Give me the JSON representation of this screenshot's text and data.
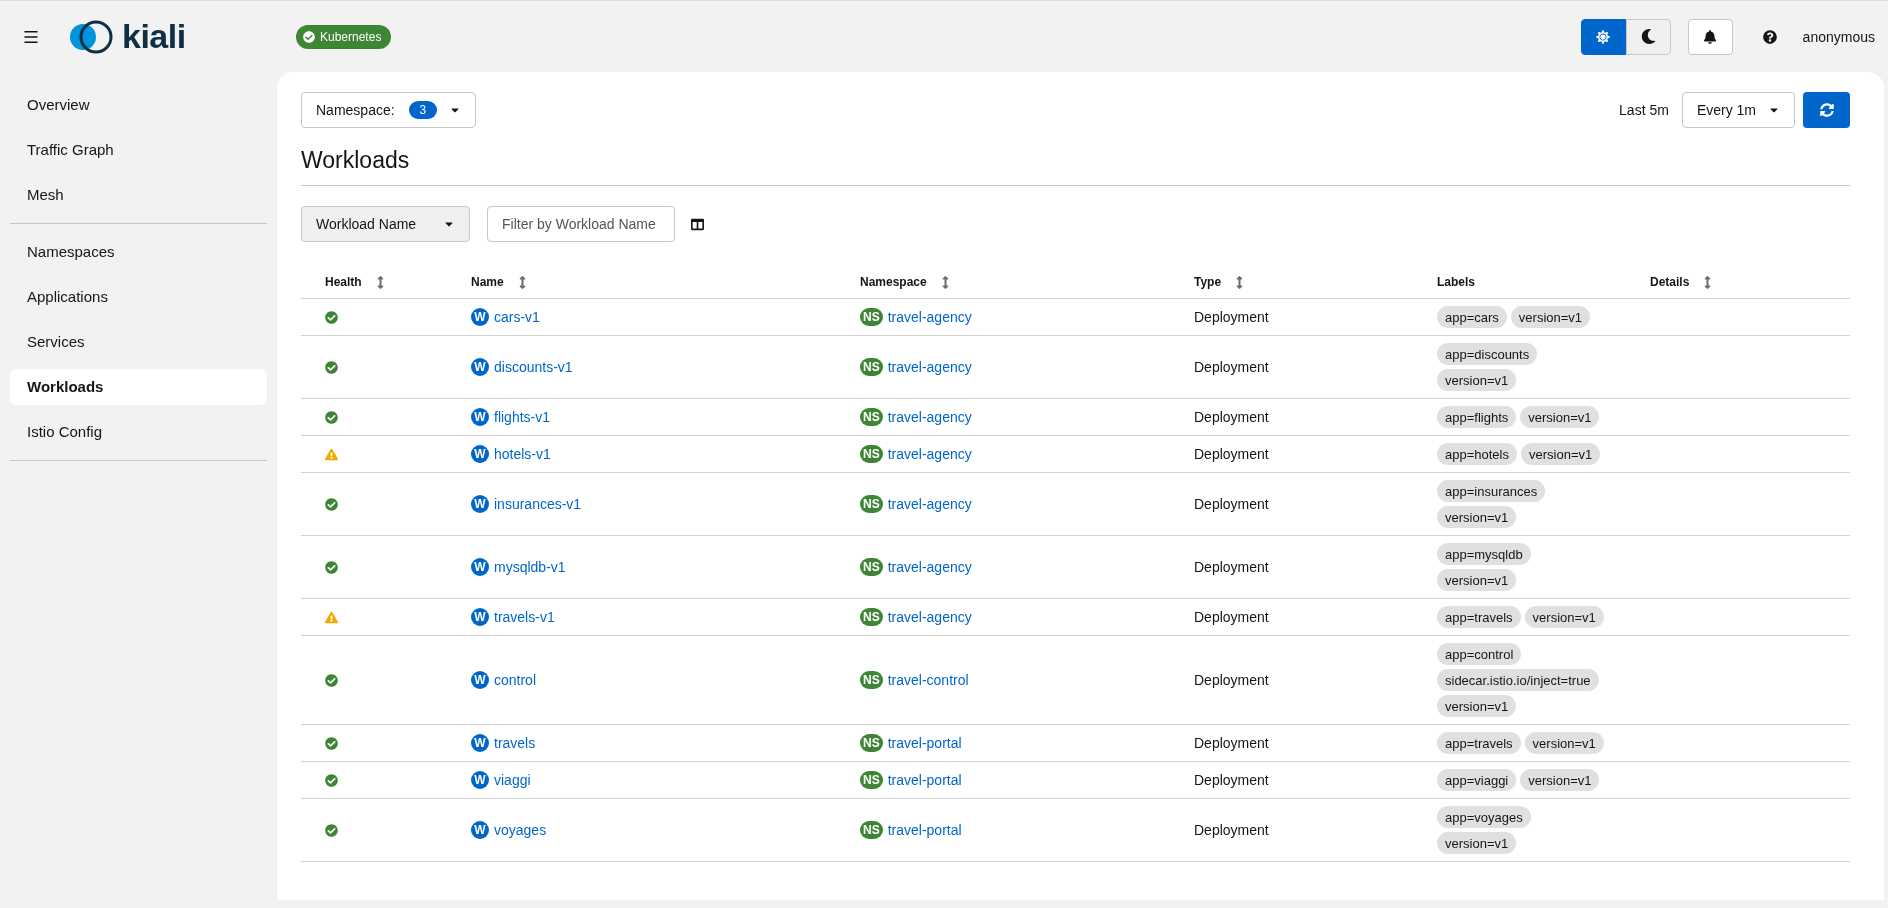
{
  "masthead": {
    "brand": "kiali",
    "cluster_badge": "Kubernetes",
    "theme_toggle": [
      {
        "kind": "light",
        "selected": true
      },
      {
        "kind": "dark",
        "selected": false
      }
    ],
    "user": "anonymous"
  },
  "sidebar": {
    "groups": [
      [
        {
          "label": "Overview",
          "selected": false
        },
        {
          "label": "Traffic Graph",
          "selected": false
        },
        {
          "label": "Mesh",
          "selected": false
        }
      ],
      [
        {
          "label": "Namespaces",
          "selected": false
        },
        {
          "label": "Applications",
          "selected": false
        },
        {
          "label": "Services",
          "selected": false
        },
        {
          "label": "Workloads",
          "selected": true
        },
        {
          "label": "Istio Config",
          "selected": false
        }
      ]
    ]
  },
  "toolbar": {
    "namespace_label": "Namespace:",
    "namespace_count": "3",
    "time_range": "Last 5m",
    "refresh_interval": "Every 1m"
  },
  "title": "Workloads",
  "filter": {
    "attribute": "Workload Name",
    "placeholder": "Filter by Workload Name"
  },
  "table": {
    "columns": [
      {
        "label": "Health",
        "sortable": true
      },
      {
        "label": "Name",
        "sortable": true
      },
      {
        "label": "Namespace",
        "sortable": true
      },
      {
        "label": "Type",
        "sortable": true
      },
      {
        "label": "Labels",
        "sortable": false
      },
      {
        "label": "Details",
        "sortable": true
      }
    ],
    "rows": [
      {
        "kind": "ok",
        "name_badge": "W",
        "name": "cars-v1",
        "namespace_badge": "NS",
        "namespace": "travel-agency",
        "type": "Deployment",
        "label_lines": [
          [
            "app=cars",
            "version=v1"
          ]
        ]
      },
      {
        "kind": "ok",
        "name_badge": "W",
        "name": "discounts-v1",
        "namespace_badge": "NS",
        "namespace": "travel-agency",
        "type": "Deployment",
        "label_lines": [
          [
            "app=discounts"
          ],
          [
            "version=v1"
          ]
        ]
      },
      {
        "kind": "ok",
        "name_badge": "W",
        "name": "flights-v1",
        "namespace_badge": "NS",
        "namespace": "travel-agency",
        "type": "Deployment",
        "label_lines": [
          [
            "app=flights",
            "version=v1"
          ]
        ]
      },
      {
        "kind": "warning",
        "name_badge": "W",
        "name": "hotels-v1",
        "namespace_badge": "NS",
        "namespace": "travel-agency",
        "type": "Deployment",
        "label_lines": [
          [
            "app=hotels",
            "version=v1"
          ]
        ]
      },
      {
        "kind": "ok",
        "name_badge": "W",
        "name": "insurances-v1",
        "namespace_badge": "NS",
        "namespace": "travel-agency",
        "type": "Deployment",
        "label_lines": [
          [
            "app=insurances"
          ],
          [
            "version=v1"
          ]
        ]
      },
      {
        "kind": "ok",
        "name_badge": "W",
        "name": "mysqldb-v1",
        "namespace_badge": "NS",
        "namespace": "travel-agency",
        "type": "Deployment",
        "label_lines": [
          [
            "app=mysqldb"
          ],
          [
            "version=v1"
          ]
        ]
      },
      {
        "kind": "warning",
        "name_badge": "W",
        "name": "travels-v1",
        "namespace_badge": "NS",
        "namespace": "travel-agency",
        "type": "Deployment",
        "label_lines": [
          [
            "app=travels",
            "version=v1"
          ]
        ]
      },
      {
        "kind": "ok",
        "name_badge": "W",
        "name": "control",
        "namespace_badge": "NS",
        "namespace": "travel-control",
        "type": "Deployment",
        "label_lines": [
          [
            "app=control"
          ],
          [
            "sidecar.istio.io/inject=true"
          ],
          [
            "version=v1"
          ]
        ]
      },
      {
        "kind": "ok",
        "name_badge": "W",
        "name": "travels",
        "namespace_badge": "NS",
        "namespace": "travel-portal",
        "type": "Deployment",
        "label_lines": [
          [
            "app=travels",
            "version=v1"
          ]
        ]
      },
      {
        "kind": "ok",
        "name_badge": "W",
        "name": "viaggi",
        "namespace_badge": "NS",
        "namespace": "travel-portal",
        "type": "Deployment",
        "label_lines": [
          [
            "app=viaggi",
            "version=v1"
          ]
        ]
      },
      {
        "kind": "ok",
        "name_badge": "W",
        "name": "voyages",
        "namespace_badge": "NS",
        "namespace": "travel-portal",
        "type": "Deployment",
        "label_lines": [
          [
            "app=voyages"
          ],
          [
            "version=v1"
          ]
        ]
      }
    ]
  }
}
